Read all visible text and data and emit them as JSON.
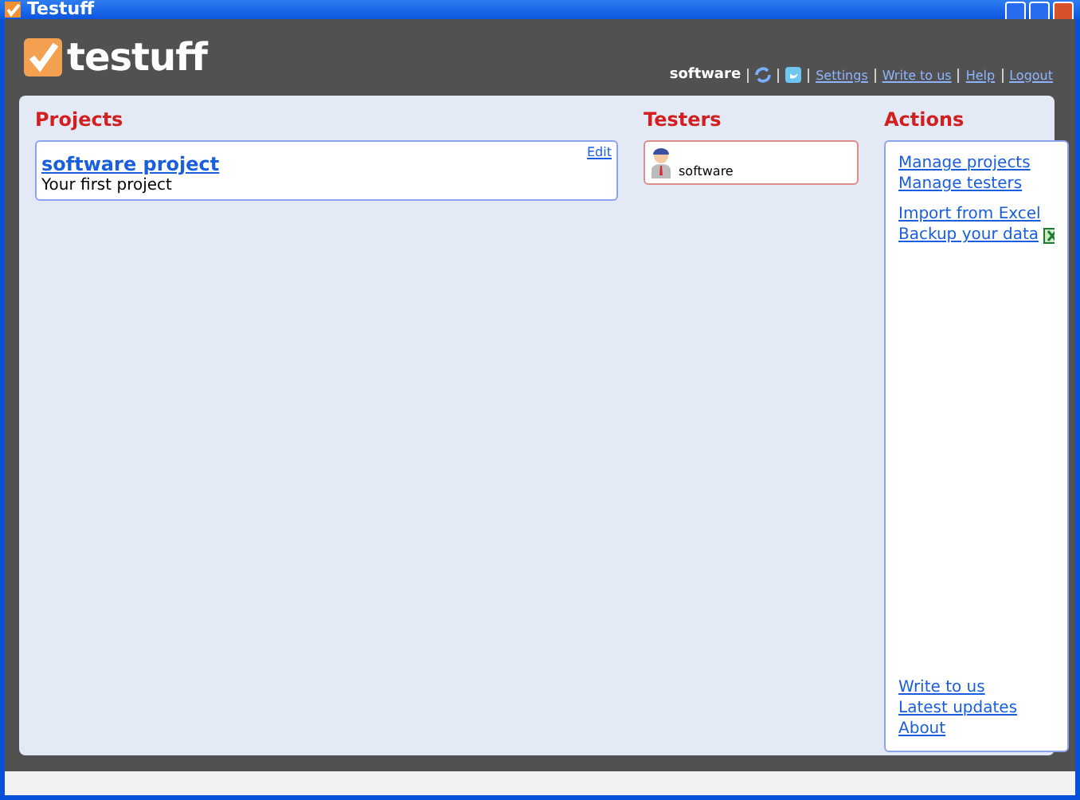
{
  "window": {
    "title": "Testuff"
  },
  "header": {
    "logo": "testuff",
    "user": "software",
    "links": [
      "Settings",
      "Write to us",
      "Help",
      "Logout"
    ]
  },
  "projects": {
    "title": "Projects",
    "items": [
      {
        "name": "software project",
        "description": "Your first project",
        "edit": "Edit"
      }
    ]
  },
  "testers": {
    "title": "Testers",
    "items": [
      {
        "name": "software",
        "selected": true
      }
    ]
  },
  "actions": {
    "title": "Actions",
    "groups": [
      [
        "Manage projects",
        "Manage testers"
      ],
      [
        "Import from Excel",
        "Backup your data"
      ]
    ],
    "bottom": [
      "Write to us",
      "Latest updates",
      "About"
    ]
  }
}
